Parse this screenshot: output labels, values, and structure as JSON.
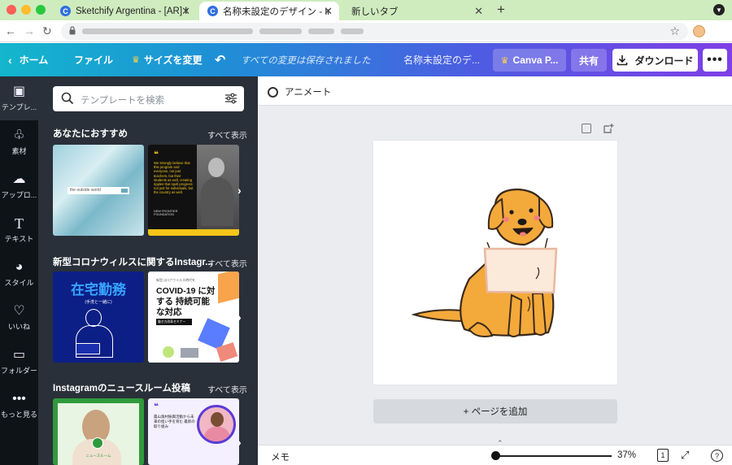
{
  "browser": {
    "tabs": [
      {
        "title": "Sketchify Argentina - [AR] Hand",
        "favicon": "C"
      },
      {
        "title": "名称未設定のデザイン - Instagram",
        "favicon": "C",
        "active": true
      },
      {
        "title": "新しいタブ"
      }
    ],
    "new_tab_icon": "plus-icon",
    "address": {
      "url_visible": false
    }
  },
  "toolbar": {
    "home": "ホーム",
    "file": "ファイル",
    "resize": "サイズを変更",
    "saved_status": "すべての変更は保存されました",
    "doc_title": "名称未設定のデ...",
    "pro_button": "Canva P...",
    "share_button": "共有",
    "download_button": "ダウンロード",
    "more_button": "•••"
  },
  "rail": {
    "items": [
      {
        "label": "テンプレ...",
        "icon": "template-icon",
        "active": true
      },
      {
        "label": "素材",
        "icon": "elements-icon"
      },
      {
        "label": "アップロ...",
        "icon": "upload-icon"
      },
      {
        "label": "テキスト",
        "icon": "text-icon"
      },
      {
        "label": "スタイル",
        "icon": "palette-icon"
      },
      {
        "label": "いいね",
        "icon": "heart-icon"
      },
      {
        "label": "フォルダー",
        "icon": "folder-icon"
      },
      {
        "label": "もっと見る",
        "icon": "more-icon"
      }
    ]
  },
  "panel": {
    "search_placeholder": "テンプレートを検索",
    "sections": [
      {
        "title": "あなたにおすすめ",
        "see_all": "すべて表示",
        "thumbs": [
          {
            "label": "the outside world"
          },
          {
            "quote": "We strongly believe that this program and everyone, not just teachers, but their students as well, creating ripples that spell progress not just for individuals, but the country as well.",
            "brand": "NEW FRONTIER FOUNDATION"
          }
        ]
      },
      {
        "title": "新型コロナウィルスに関するInstagr...",
        "see_all": "すべて表示",
        "thumbs": [
          {
            "heading": "在宅勤務",
            "sub": "(手洗と一緒に)"
          },
          {
            "small": "新型コロナウイルス時代を",
            "heading": "COVID-19 に対する 持続可能な対応",
            "badge": "働き方改革セミナー"
          }
        ]
      },
      {
        "title": "Instagramのニュースルーム投稿",
        "see_all": "すべて表示",
        "thumbs": [
          {
            "caption": "ニュースルーム"
          },
          {
            "text": "農山漁村振興活動から未来の担い手を育む 最新の取り組み"
          }
        ]
      }
    ]
  },
  "workspace": {
    "animate": "アニメート",
    "add_page": "+ ページを追加",
    "memo": "メモ",
    "zoom": "37%",
    "page_count": "1",
    "help": "?"
  },
  "colors": {
    "toolbar_start": "#13b6cd",
    "toolbar_end": "#7f3fe6",
    "rail_bg": "#0e1318",
    "panel_bg": "#293039",
    "workspace_bg": "#ebecf0",
    "dog_fur": "#f4a93b",
    "sign": "#fbe9d9"
  }
}
